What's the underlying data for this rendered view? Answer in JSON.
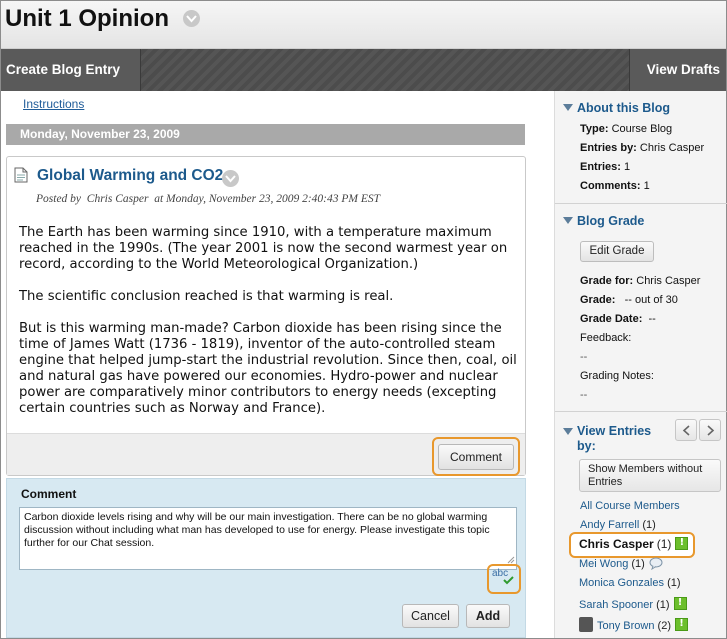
{
  "page": {
    "title": "Unit 1 Opinion"
  },
  "actionbar": {
    "create_label": "Create Blog Entry",
    "drafts_label": "View Drafts"
  },
  "content": {
    "instructions_link": "Instructions",
    "date_header": "Monday, November 23, 2009",
    "entry": {
      "title": "Global Warming and CO2",
      "posted_prefix": "Posted by",
      "author": "Chris Casper",
      "posted_at": "at Monday, November 23, 2009 2:40:43 PM EST",
      "paragraphs": [
        "The Earth has been warming since 1910, with a temperature maximum reached in the 1990s. (The year 2001 is now the second warmest year on record, according to the World Meteorological Organization.)",
        "The scientific conclusion reached is that warming is real.",
        "But is this warming man-made? Carbon dioxide has been rising since the time of James Watt (1736 - 1819), inventor of the auto-controlled steam engine that helped jump-start the industrial revolution. Since then, coal, oil and natural gas have powered our economies. Hydro-power and nuclear power are comparatively minor contributors to energy needs (excepting certain countries such as Norway and France)."
      ],
      "comment_button": "Comment"
    },
    "comment_form": {
      "label": "Comment",
      "value": "Carbon dioxide levels rising and why will be our main investigation. There can be no global warming discussion without including what man has developed to use for energy. Please investigate this topic further for our Chat session.",
      "spellcheck": "abc",
      "cancel_label": "Cancel",
      "add_label": "Add"
    }
  },
  "sidebar": {
    "about": {
      "title": "About this Blog",
      "type_label": "Type:",
      "type_value": "Course Blog",
      "entries_by_label": "Entries by:",
      "entries_by_value": "Chris Casper",
      "entries_label": "Entries:",
      "entries_value": "1",
      "comments_label": "Comments:",
      "comments_value": "1"
    },
    "grade": {
      "title": "Blog Grade",
      "edit_button": "Edit Grade",
      "grade_for_label": "Grade for:",
      "grade_for_value": "Chris Casper",
      "grade_label": "Grade:",
      "grade_value": "-- out of 30",
      "grade_date_label": "Grade Date:",
      "grade_date_value": "--",
      "feedback_label": "Feedback:",
      "feedback_value": "--",
      "notes_label": "Grading Notes:",
      "notes_value": "--"
    },
    "view_entries": {
      "title": "View Entries by:",
      "show_members_button": "Show Members without Entries",
      "all_members": "All Course Members",
      "members": [
        {
          "name": "Andy Farrell",
          "count": "(1)",
          "badge": "none"
        },
        {
          "name": "Chris Casper",
          "count": "(1)",
          "badge": "flag"
        },
        {
          "name": "Mei Wong",
          "count": "(1)",
          "badge": "comment-bubble"
        },
        {
          "name": "Monica Gonzales",
          "count": "(1)",
          "badge": "none"
        },
        {
          "name": "Sarah Spooner",
          "count": "(1)",
          "badge": "flag"
        },
        {
          "name": "Tony Brown",
          "count": "(2)",
          "badge": "flag"
        }
      ]
    }
  },
  "colors": {
    "link": "#1d5a8c",
    "highlight": "#e8982d",
    "comment_panel": "#d7e9f2",
    "flag": "#6cbf2c"
  }
}
